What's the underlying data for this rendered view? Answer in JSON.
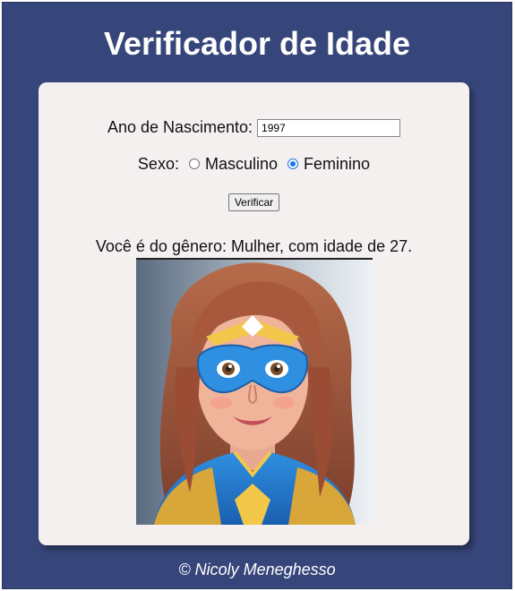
{
  "header": {
    "title": "Verificador de Idade"
  },
  "form": {
    "birth_label": "Ano de Nascimento:",
    "birth_value": "1997",
    "sex_label": "Sexo:",
    "options": [
      {
        "label": "Masculino",
        "checked": false
      },
      {
        "label": "Feminino",
        "checked": true
      }
    ],
    "verify_label": "Verificar"
  },
  "result": {
    "text": "Você é do gênero: Mulher, com idade de 27."
  },
  "footer": {
    "text": "© Nicoly Meneghesso"
  },
  "colors": {
    "page_bg": "#36457a",
    "card_bg": "#f5f0f0",
    "accent": "#1a73e8"
  }
}
